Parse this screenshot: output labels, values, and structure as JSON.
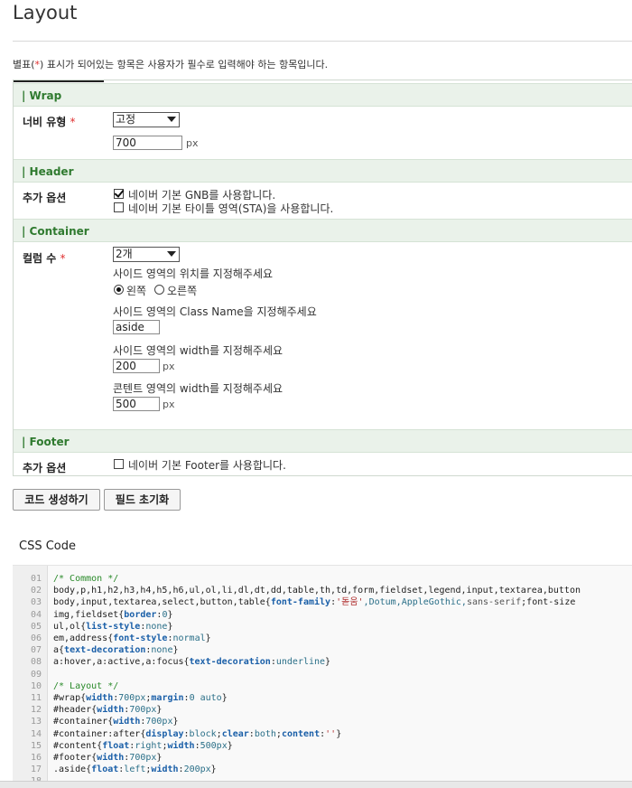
{
  "page": {
    "title": "Layout",
    "notice_prefix": "별표(",
    "notice_star": "*",
    "notice_suffix": ") 표시가 되어있는 항목은 사용자가 필수로 입력해야 하는 항목입니다."
  },
  "wrap": {
    "heading": "| Wrap",
    "width_type_label": "너비 유형",
    "width_type_value": "고정",
    "width_value": "700",
    "width_unit": "px"
  },
  "header": {
    "heading": "| Header",
    "options_label": "추가 옵션",
    "gnb_label": "네이버 기본 GNB를 사용합니다.",
    "gnb_checked": true,
    "sta_label": "네이버 기본 타이틀 영역(STA)을 사용합니다.",
    "sta_checked": false
  },
  "container": {
    "heading": "| Container",
    "columns_label": "컬럼 수",
    "columns_value": "2개",
    "side_position_prompt": "사이드 영역의 위치를 지정해주세요",
    "position_left": "왼쪽",
    "position_right": "오른쪽",
    "position_selected": "left",
    "side_class_prompt": "사이드 영역의 Class Name을 지정해주세요",
    "side_class_value": "aside",
    "side_width_prompt": "사이드 영역의 width를 지정해주세요",
    "side_width_value": "200",
    "content_width_prompt": "콘텐트 영역의 width를 지정해주세요",
    "content_width_value": "500",
    "unit": "px"
  },
  "footer": {
    "heading": "| Footer",
    "options_label": "추가 옵션",
    "footer_label": "네이버 기본 Footer를 사용합니다.",
    "footer_checked": false
  },
  "actions": {
    "generate_label": "코드 생성하기",
    "reset_label": "필드 초기화"
  },
  "css_code": {
    "title": "CSS Code",
    "lines": [
      {
        "n": "01",
        "t": "/* Common */"
      },
      {
        "n": "02",
        "t": "body,p,h1,h2,h3,h4,h5,h6,ul,ol,li,dl,dt,dd,table,th,td,form,fieldset,legend,input,textarea,button"
      },
      {
        "n": "03",
        "t": "body,input,textarea,select,button,table{font-family:'돋움',Dotum,AppleGothic,sans-serif;font-size"
      },
      {
        "n": "04",
        "t": "img,fieldset{border:0}"
      },
      {
        "n": "05",
        "t": "ul,ol{list-style:none}"
      },
      {
        "n": "06",
        "t": "em,address{font-style:normal}"
      },
      {
        "n": "07",
        "t": "a{text-decoration:none}"
      },
      {
        "n": "08",
        "t": "a:hover,a:active,a:focus{text-decoration:underline}"
      },
      {
        "n": "09",
        "t": ""
      },
      {
        "n": "10",
        "t": "/* Layout */"
      },
      {
        "n": "11",
        "t": "#wrap{width:700px;margin:0 auto}"
      },
      {
        "n": "12",
        "t": "#header{width:700px}"
      },
      {
        "n": "13",
        "t": "#container{width:700px}"
      },
      {
        "n": "14",
        "t": "#container:after{display:block;clear:both;content:''}"
      },
      {
        "n": "15",
        "t": "#content{float:right;width:500px}"
      },
      {
        "n": "16",
        "t": "#footer{width:700px}"
      },
      {
        "n": "17",
        "t": ".aside{float:left;width:200px}"
      },
      {
        "n": "18",
        "t": ""
      }
    ]
  }
}
